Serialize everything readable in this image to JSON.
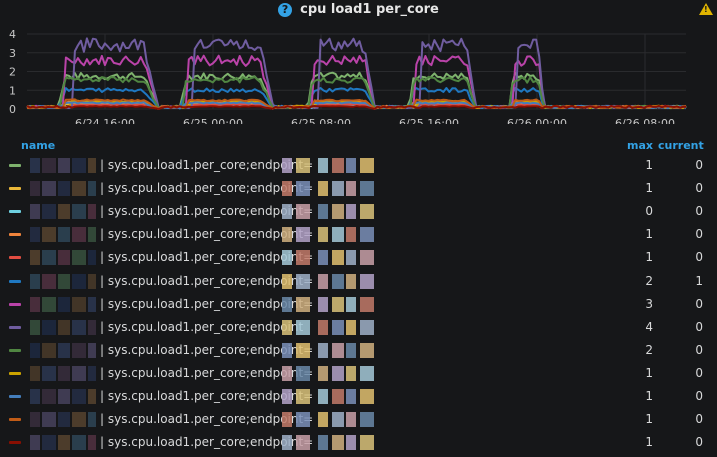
{
  "panel": {
    "title": "cpu load1 per_core",
    "info_icon": "question-circle-icon",
    "warning_icon": "warning-triangle-icon",
    "background": "#161719"
  },
  "legend": {
    "columns": {
      "name": "name",
      "max": "max",
      "current": "current"
    },
    "rows": [
      {
        "label": "| sys.cpu.load1.per_core;endpoint=",
        "color": "#7eb26d",
        "max": "1",
        "current": "0"
      },
      {
        "label": "| sys.cpu.load1.per_core;endpoint=",
        "color": "#eab839",
        "max": "1",
        "current": "0"
      },
      {
        "label": "| sys.cpu.load1.per_core;endpoint=",
        "color": "#6ed0e0",
        "max": "0",
        "current": "0"
      },
      {
        "label": "| sys.cpu.load1.per_core;endpoint=",
        "color": "#ef843c",
        "max": "1",
        "current": "0"
      },
      {
        "label": "| sys.cpu.load1.per_core;endpoint=",
        "color": "#e24d42",
        "max": "1",
        "current": "0"
      },
      {
        "label": "| sys.cpu.load1.per_core;endpoint=",
        "color": "#1f78c1",
        "max": "2",
        "current": "1"
      },
      {
        "label": "| sys.cpu.load1.per_core;endpoint=",
        "color": "#ba43a9",
        "max": "3",
        "current": "0"
      },
      {
        "label": "| sys.cpu.load1.per_core;endpoint",
        "color": "#705da0",
        "max": "4",
        "current": "0"
      },
      {
        "label": "| sys.cpu.load1.per_core;endpoint=",
        "color": "#508642",
        "max": "2",
        "current": "0"
      },
      {
        "label": "| sys.cpu.load1.per_core;endpoint=",
        "color": "#cca300",
        "max": "1",
        "current": "0"
      },
      {
        "label": "| sys.cpu.load1.per_core;endpoint=",
        "color": "#447ebc",
        "max": "1",
        "current": "0"
      },
      {
        "label": "| sys.cpu.load1.per_core;endpoint=",
        "color": "#c15c17",
        "max": "1",
        "current": "0"
      },
      {
        "label": "| sys.cpu.load1.per_core;endpoint=",
        "color": "#890f02",
        "max": "1",
        "current": "0"
      }
    ]
  },
  "chart_data": {
    "type": "line",
    "title": "cpu load1 per_core",
    "ylim": [
      0,
      4
    ],
    "yticks": [
      "0",
      "1",
      "2",
      "3",
      "4"
    ],
    "xticks": [
      "6/24 16:00",
      "6/25 00:00",
      "6/25 08:00",
      "6/25 16:00",
      "6/26 00:00",
      "6/26 08:00"
    ],
    "grid": true,
    "legend_placement": "bottom",
    "busy_windows": [
      {
        "start": "6/24 12:30",
        "end": "6/24 20:00"
      },
      {
        "start": "6/24 21:30",
        "end": "6/25 04:30"
      },
      {
        "start": "6/25 07:00",
        "end": "6/25 12:00"
      },
      {
        "start": "6/25 14:30",
        "end": "6/25 19:30"
      },
      {
        "start": "6/25 22:00",
        "end": "6/26 00:30"
      }
    ],
    "series": [
      {
        "color": "#7eb26d",
        "peak": 1.9
      },
      {
        "color": "#eab839",
        "peak": 0.3
      },
      {
        "color": "#6ed0e0",
        "peak": 0.2
      },
      {
        "color": "#ef843c",
        "peak": 0.4
      },
      {
        "color": "#e24d42",
        "peak": 0.25
      },
      {
        "color": "#1f78c1",
        "peak": 1.1
      },
      {
        "color": "#ba43a9",
        "peak": 2.8
      },
      {
        "color": "#705da0",
        "peak": 3.7
      },
      {
        "color": "#508642",
        "peak": 1.7
      },
      {
        "color": "#cca300",
        "peak": 0.45
      },
      {
        "color": "#447ebc",
        "peak": 0.35
      },
      {
        "color": "#c15c17",
        "peak": 0.5
      },
      {
        "color": "#890f02",
        "peak": 0.15
      }
    ]
  }
}
